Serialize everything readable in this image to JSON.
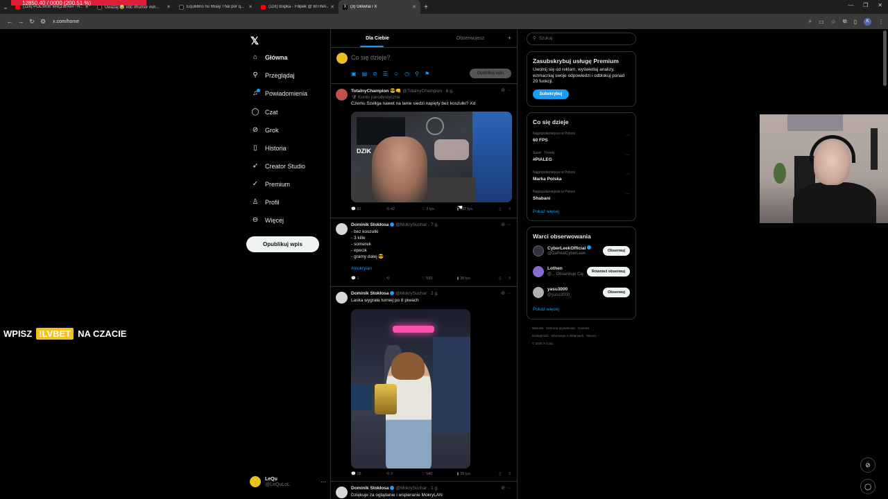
{
  "browser": {
    "rec_label": "12850.40 / 0000 (200.51 %)",
    "tabs": [
      {
        "title": "(116) POLSKIE WIĘZIENIA - R...",
        "color": "#ff0000"
      },
      {
        "title": "Uważaj 😂 #dc #humor #sh...",
        "color": "#111111"
      },
      {
        "title": "Equilibrio no Muay Thai por q...",
        "color": "#111111"
      },
      {
        "title": "(116) Bapka - Filipek @ BITWA...",
        "color": "#ff0000"
      },
      {
        "title": "(3) Główna / X",
        "color": "#ffffff"
      }
    ],
    "url": "x.com/home",
    "profile_initial": "K"
  },
  "nav": {
    "items": [
      {
        "label": "Główna",
        "icon": "home-icon"
      },
      {
        "label": "Przeglądaj",
        "icon": "search-icon"
      },
      {
        "label": "Powiadomienia",
        "icon": "bell-icon"
      },
      {
        "label": "Czat",
        "icon": "chat-icon"
      },
      {
        "label": "Grok",
        "icon": "grok-icon"
      },
      {
        "label": "Historia",
        "icon": "bookmark-icon"
      },
      {
        "label": "Creator Studio",
        "icon": "rocket-icon"
      },
      {
        "label": "Premium",
        "icon": "verified-icon"
      },
      {
        "label": "Profil",
        "icon": "person-icon"
      },
      {
        "label": "Więcej",
        "icon": "more-circle-icon"
      }
    ],
    "post_button": "Opublikuj wpis",
    "account": {
      "name": "LeQu",
      "handle": "@LeQuLoL"
    }
  },
  "timeline": {
    "tabs": [
      "Dla Ciebie",
      "Obserwujesz"
    ],
    "compose_placeholder": "Co się dzieje?",
    "publish_label": "Opublikuj wpis",
    "posts": [
      {
        "name": "TotalnyChampion 😎👊",
        "handle": "@TotalnyChampion · 6 g.",
        "subline": "🛡 Konto parodystyczne",
        "text": "Czemu Szeliga nawet na lanie siedzi napięty bez koszulki? Xd",
        "media_label": "DZIK",
        "stats": {
          "replies": "82",
          "reposts": "42",
          "likes": "3 tys.",
          "views": "187 tys."
        },
        "avatar_color": "#c0504d"
      },
      {
        "name": "Dominik Stokłosa",
        "handle": "@MokrySuchar · 7 g.",
        "lines": [
          "- bez koszulki",
          "- 3 kille",
          "- somerek",
          "- epecik",
          "- gramy dalej 😎"
        ],
        "hashtag": "#mokrylan",
        "stats": {
          "replies": "1",
          "reposts": "",
          "likes": "593",
          "views": "38 tys."
        },
        "avatar_color": "#d8d8d8"
      },
      {
        "name": "Dominik Stokłosa",
        "handle": "@MokrySuchar · 2 g.",
        "text": "Laska wygrała turniej po 8 piwach",
        "stats": {
          "replies": "18",
          "reposts": "3",
          "likes": "540",
          "views": "39 tys."
        },
        "avatar_color": "#d8d8d8"
      },
      {
        "name": "Dominik Stokłosa",
        "handle": "@MokrySuchar · 1 g.",
        "text": "Dziękuje za oglądanie i wspieranie MokryLAN",
        "avatar_color": "#d8d8d8"
      }
    ]
  },
  "sidebar": {
    "search_placeholder": "Szukaj",
    "premium": {
      "title": "Zasubskrybuj usługę Premium",
      "text": "Uwolnij się od reklam, wyświetlaj analizy, wzmacniaj swoje odpowiedzi i odblokuj ponad 20 funkcji.",
      "button": "Subskrybuj"
    },
    "trends": {
      "title": "Co się dzieje",
      "items": [
        {
          "context": "Najpopularniejsze w Polsce",
          "topic": "60 FPS"
        },
        {
          "context": "Sport · Trendy",
          "topic": "#PIALEG"
        },
        {
          "context": "Najpopularniejsze w Polsce",
          "topic": "Marka Polska"
        },
        {
          "context": "Najpopularniejsze w Polsce",
          "topic": "Shabani"
        }
      ],
      "more": "Pokaż więcej"
    },
    "who_to_follow": {
      "title": "Warci obserwowania",
      "items": [
        {
          "name": "CyberLeekOfficial",
          "handle": "@DaRealCyberLeek",
          "button": "Obserwuj",
          "avatar": "#333344"
        },
        {
          "name": "Lothen",
          "handle": "@... Obserwuje Cię",
          "button": "Również obserwuj",
          "avatar": "#8a6ad0"
        },
        {
          "name": "yasu3000",
          "handle": "@yasu3000_",
          "button": "Obserwuj",
          "avatar": "#b0b0b0"
        }
      ],
      "more": "Pokaż więcej"
    },
    "footer": [
      "Warunki",
      "Ochrona prywatności",
      "Cookies",
      "Dostępność",
      "Informacje o reklamach",
      "Więcej ···",
      "© 2025 X Corp."
    ]
  },
  "overlay": {
    "promo_prefix": "WPISZ",
    "promo_code": "!LVBET",
    "promo_suffix": "NA CZACIE"
  }
}
